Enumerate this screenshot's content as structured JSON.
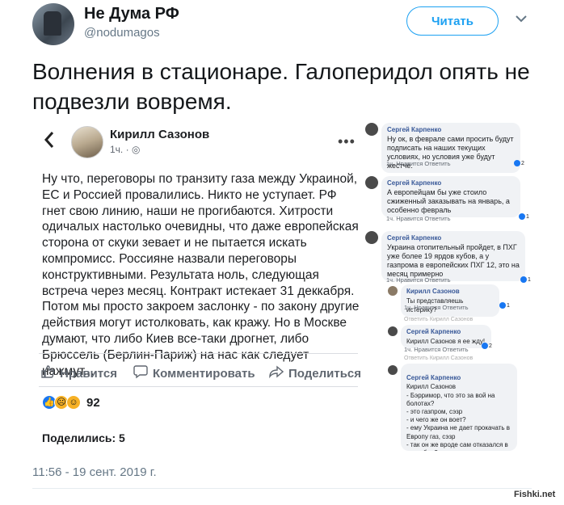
{
  "account": {
    "name": "Не Дума РФ",
    "handle": "@nodumagos",
    "follow_label": "Читать",
    "menu_icon": "chevron-down-icon"
  },
  "tweet": {
    "text": "Волнения в стационаре. Галоперидол опять не подвезли вовремя.",
    "date": "11:56 - 19 сент. 2019 г."
  },
  "post": {
    "author": "Кирилл Сазонов",
    "time": "1ч. · ",
    "body": "Ну что, переговоры по транзиту газа между Украиной, ЕС и Россией провалились. Никто не уступает. РФ гнет свою линию, наши не прогибаются. Хитрости одичалых настолько очевидны, что даже европейская сторона от скуки зевает и не пытается искать компромисс. Россияне назвали переговоры конструктивными. Результата ноль, следующая встреча через месяц. Контракт истекает 31 деккабря. Потом мы просто закроем заслонку - по закону другие действия могут истолковать, как кражу. Но в Москве думают, что либо Киев все-таки дрогнет, либо Брюссель (Берлин-Париж) на нас как следует нажмут...",
    "like_label": "Нравится",
    "comment_label": "Комментировать",
    "share_label": "Поделиться",
    "reactions_count": "92",
    "shared_label": "Поделились: 5"
  },
  "comments": [
    {
      "author": "Сергей Карпенко",
      "text": "Ну ок, в феврале сами просить будут подписать на наших текущих условиях, но условия уже будут жестче.",
      "meta": "1ч.   Нравится   Ответить",
      "badge": "2"
    },
    {
      "author": "Сергей Карпенко",
      "text": "А европейцам бы уже стоило сжиженный заказывать на январь, а особенно февраль",
      "meta": "1ч.   Нравится   Ответить",
      "badge": "1"
    },
    {
      "author": "Сергей Карпенко",
      "text": "Украина отопительный пройдет, в ПХГ уже более 19 ярдов кубов, а у газпрома в европейских ПХГ 12, это на месяц примерно",
      "meta": "1ч.   Нравится   Ответить",
      "badge": "1"
    },
    {
      "author": "Кирилл Сазонов",
      "text": "Ты представляешь истерику?",
      "meta": "1ч.   Нравится   Ответить",
      "badge": "1"
    },
    {
      "author": "Сергей Карпенко",
      "text": "Кирилл Сазонов я ее жду!",
      "meta": "1ч.   Нравится   Ответить",
      "badge": "2"
    },
    {
      "author": "Сергей Карпенко",
      "text": "Кирилл Сазонов\n- Бэрримор, что это за вой на болотах?\n- это газпром, сэзр\n- и чего же он воет?\n- ему Украина не дает прокачать в Европу газ, сэзр\n- так он же вроде сам отказался в сентябре?\n- имбецил, сэзр",
      "meta": "",
      "badge": ""
    }
  ],
  "reply_hint": "Ответить Кирилл Сазонов",
  "watermark": "Fishki.net",
  "colors": {
    "accent": "#1da1f2",
    "fb_link": "#385898",
    "muted": "#657786"
  }
}
